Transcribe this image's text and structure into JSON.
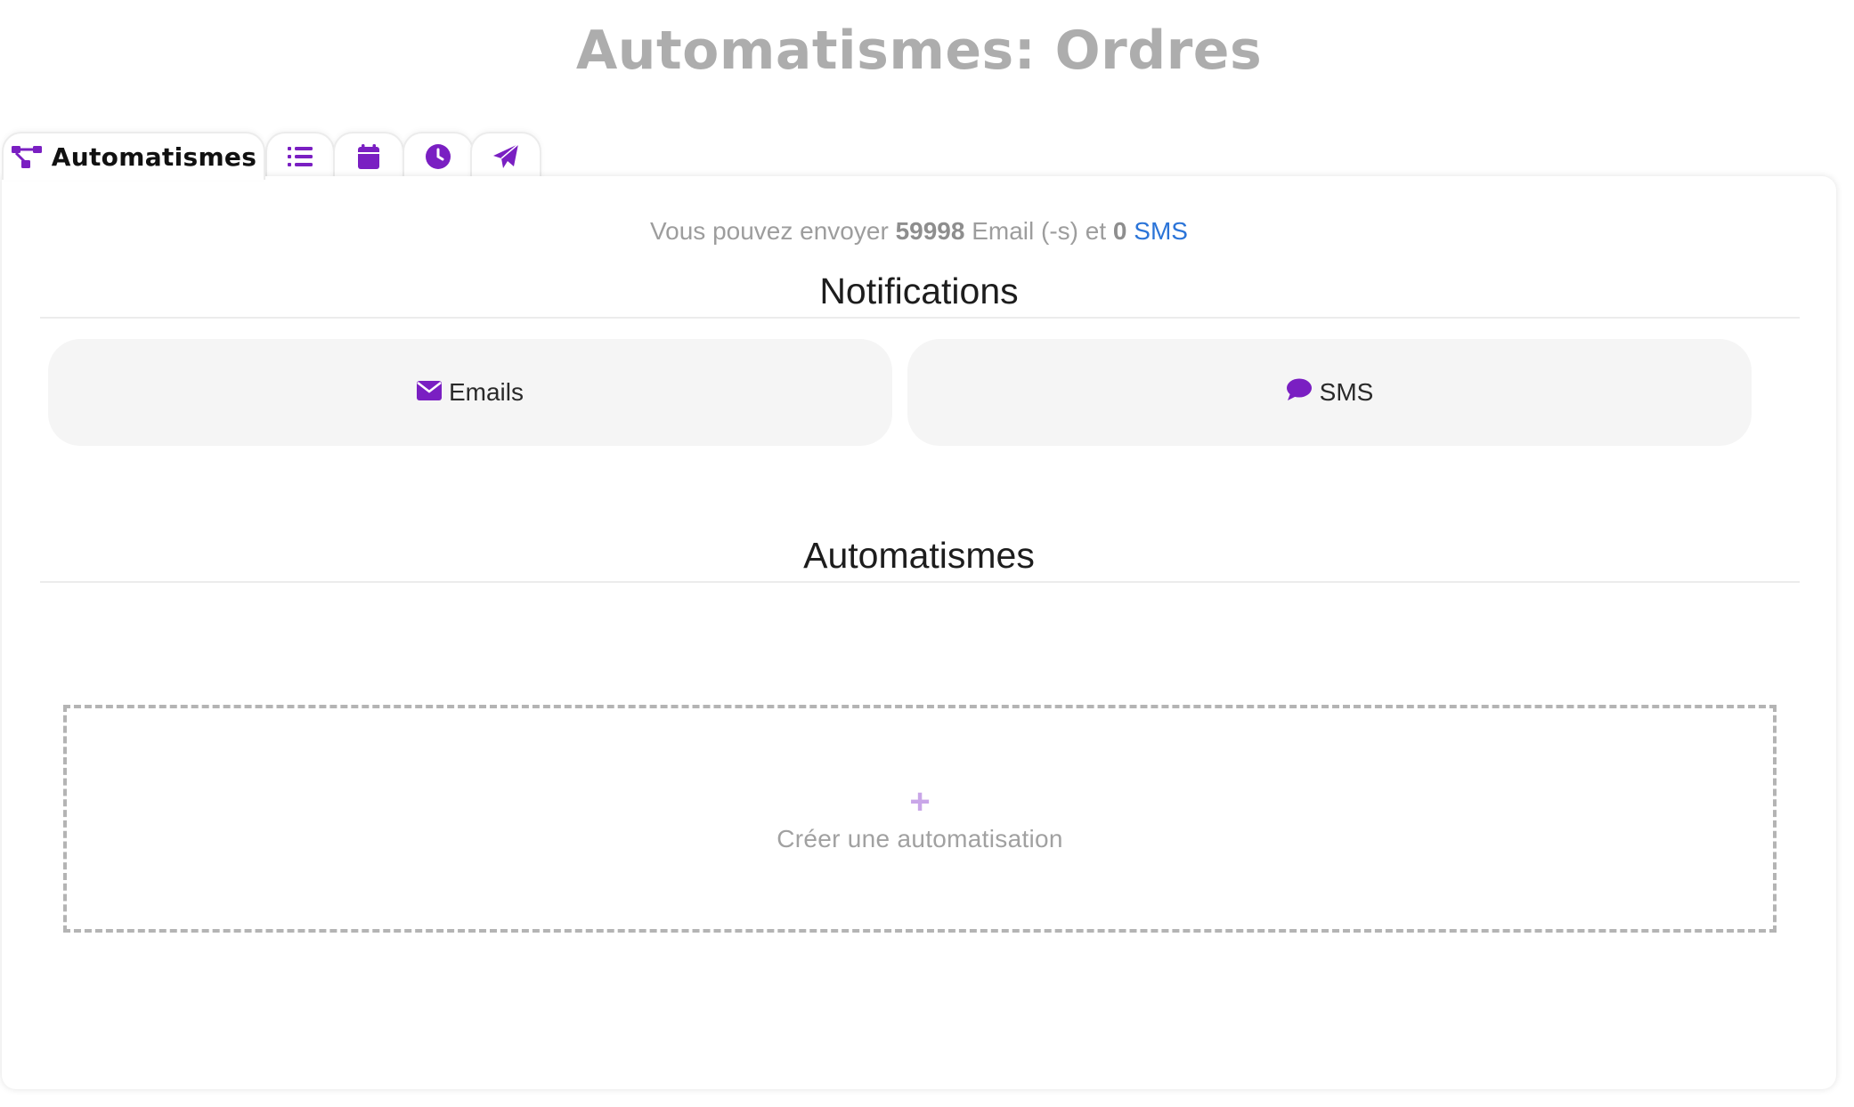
{
  "title": "Automatismes: Ordres",
  "tabs": [
    {
      "label": "Automatismes",
      "icon": "workflow-icon",
      "active": true
    },
    {
      "label": "",
      "icon": "list-icon"
    },
    {
      "label": "",
      "icon": "calendar-icon"
    },
    {
      "label": "",
      "icon": "clock-icon"
    },
    {
      "label": "",
      "icon": "paper-plane-icon"
    }
  ],
  "quota": {
    "prefix": "Vous pouvez envoyer",
    "email_count": "59998",
    "email_label": "Email (-s) et",
    "sms_count": "0",
    "sms_label": "SMS"
  },
  "notifications": {
    "heading": "Notifications",
    "emails_label": "Emails",
    "sms_label": "SMS"
  },
  "automatismes": {
    "heading": "Automatismes",
    "create_label": "Créer une automatisation",
    "plus": "+"
  },
  "colors": {
    "accent": "#7a1fc2",
    "link": "#2b74d8",
    "title": "#adadad"
  }
}
